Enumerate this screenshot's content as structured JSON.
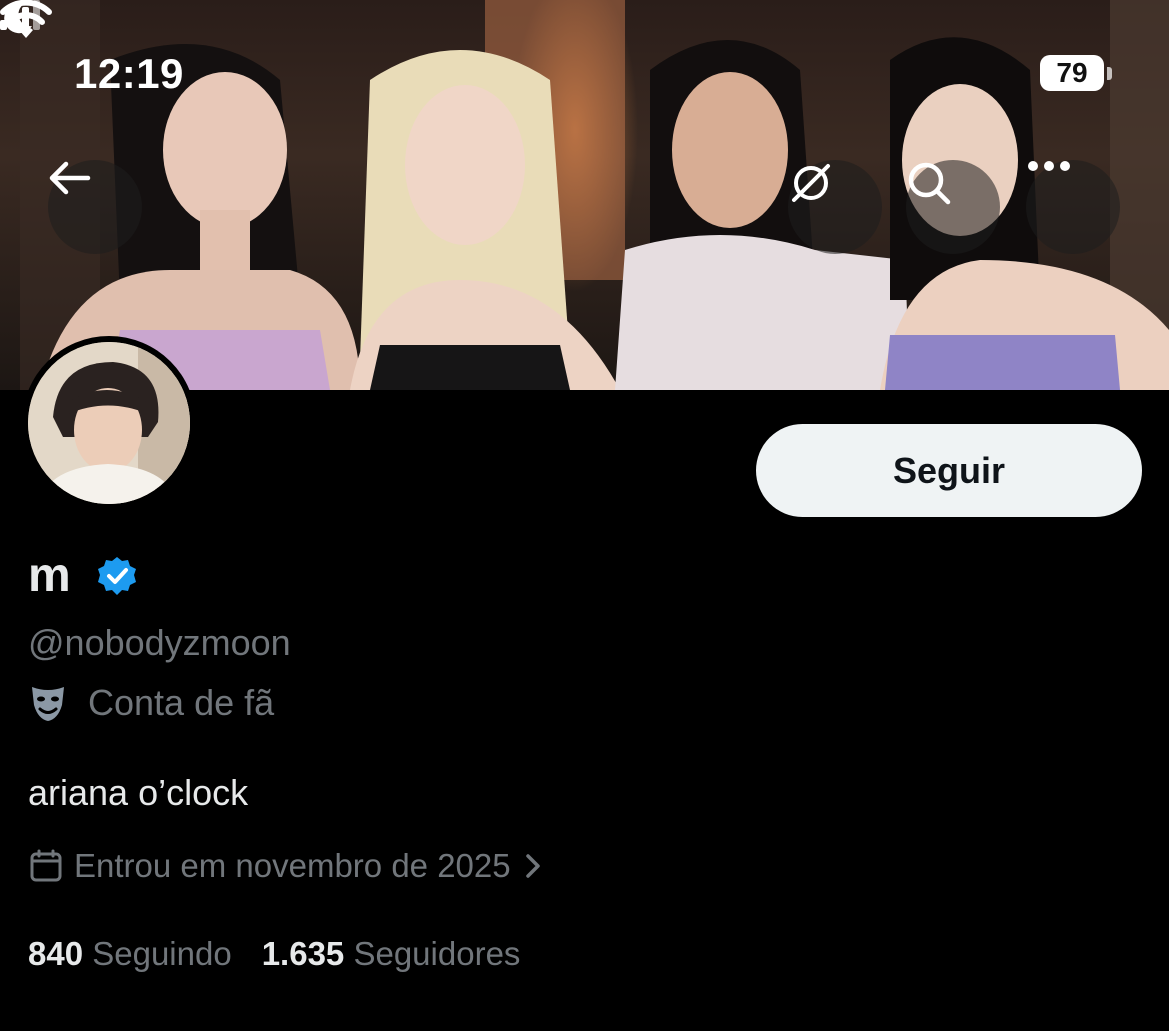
{
  "status_bar": {
    "time": "12:19",
    "battery": "79"
  },
  "header": {
    "banner_image": "group-photo-banner"
  },
  "profile": {
    "follow_label": "Seguir",
    "name": "m",
    "handle": "@nobodyzmoon",
    "category": "Conta de fã",
    "bio": "ariana o’clock",
    "joined": "Entrou em novembro de 2025",
    "following_count": "840",
    "following_label": "Seguindo",
    "followers_count": "1.635",
    "followers_label": "Seguidores"
  },
  "colors": {
    "verified": "#1d9bf0",
    "muted": "#71767b",
    "text": "#e7e9ea",
    "background": "#000000"
  }
}
